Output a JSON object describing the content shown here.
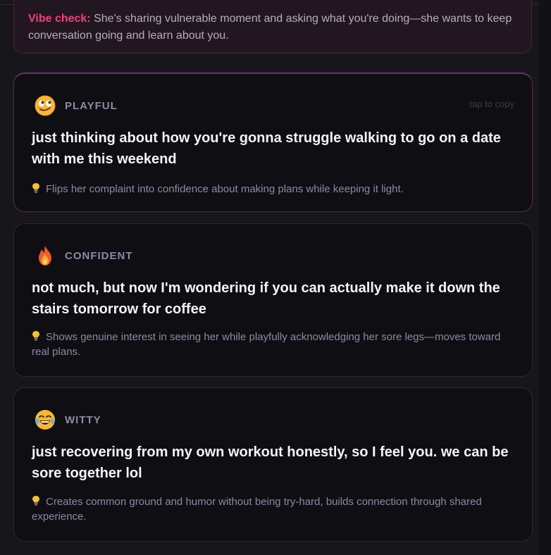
{
  "vibe_check": {
    "label": "Vibe check:",
    "text": " She's sharing vulnerable moment and asking what you're doing—she wants to keep conversation going and learn about you."
  },
  "cards": [
    {
      "tone": "PLAYFUL",
      "emoji_icon": "playful-face-icon",
      "copy_hint": "tap to copy",
      "reply": "just thinking about how you're gonna struggle walking to go on a date with me this weekend",
      "explanation": "Flips her complaint into confidence about making plans while keeping it light."
    },
    {
      "tone": "CONFIDENT",
      "emoji_icon": "fire-icon",
      "reply": "not much, but now I'm wondering if you can actually make it down the stairs tomorrow for coffee",
      "explanation": "Shows genuine interest in seeing her while playfully acknowledging her sore legs—moves toward real plans."
    },
    {
      "tone": "WITTY",
      "emoji_icon": "laughing-tears-icon",
      "reply": "just recovering from my own workout honestly, so I feel you. we can be sore together lol",
      "explanation": "Creates common ground and humor without being try-hard, builds connection through shared experience."
    }
  ],
  "colors": {
    "accent_pink": "#ee3f82",
    "background": "#16161b",
    "card_background": "#0e0e13"
  }
}
